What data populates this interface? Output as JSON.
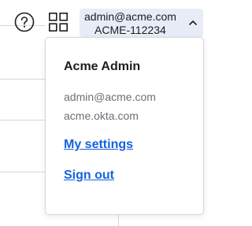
{
  "topbar": {
    "help_icon": "help-circle-icon",
    "apps_icon": "apps-grid-icon",
    "account": {
      "email": "admin@acme.com",
      "org_id": "ACME-112234",
      "chevron_icon": "chevron-up-icon"
    }
  },
  "menu": {
    "name": "Acme Admin",
    "email": "admin@acme.com",
    "domain": "acme.okta.com",
    "settings_label": "My settings",
    "signout_label": "Sign out"
  },
  "colors": {
    "link": "#1662dd",
    "account_bg": "#e8ecf7",
    "secondary_text": "#6e6e78",
    "border": "#d7d7dc"
  }
}
